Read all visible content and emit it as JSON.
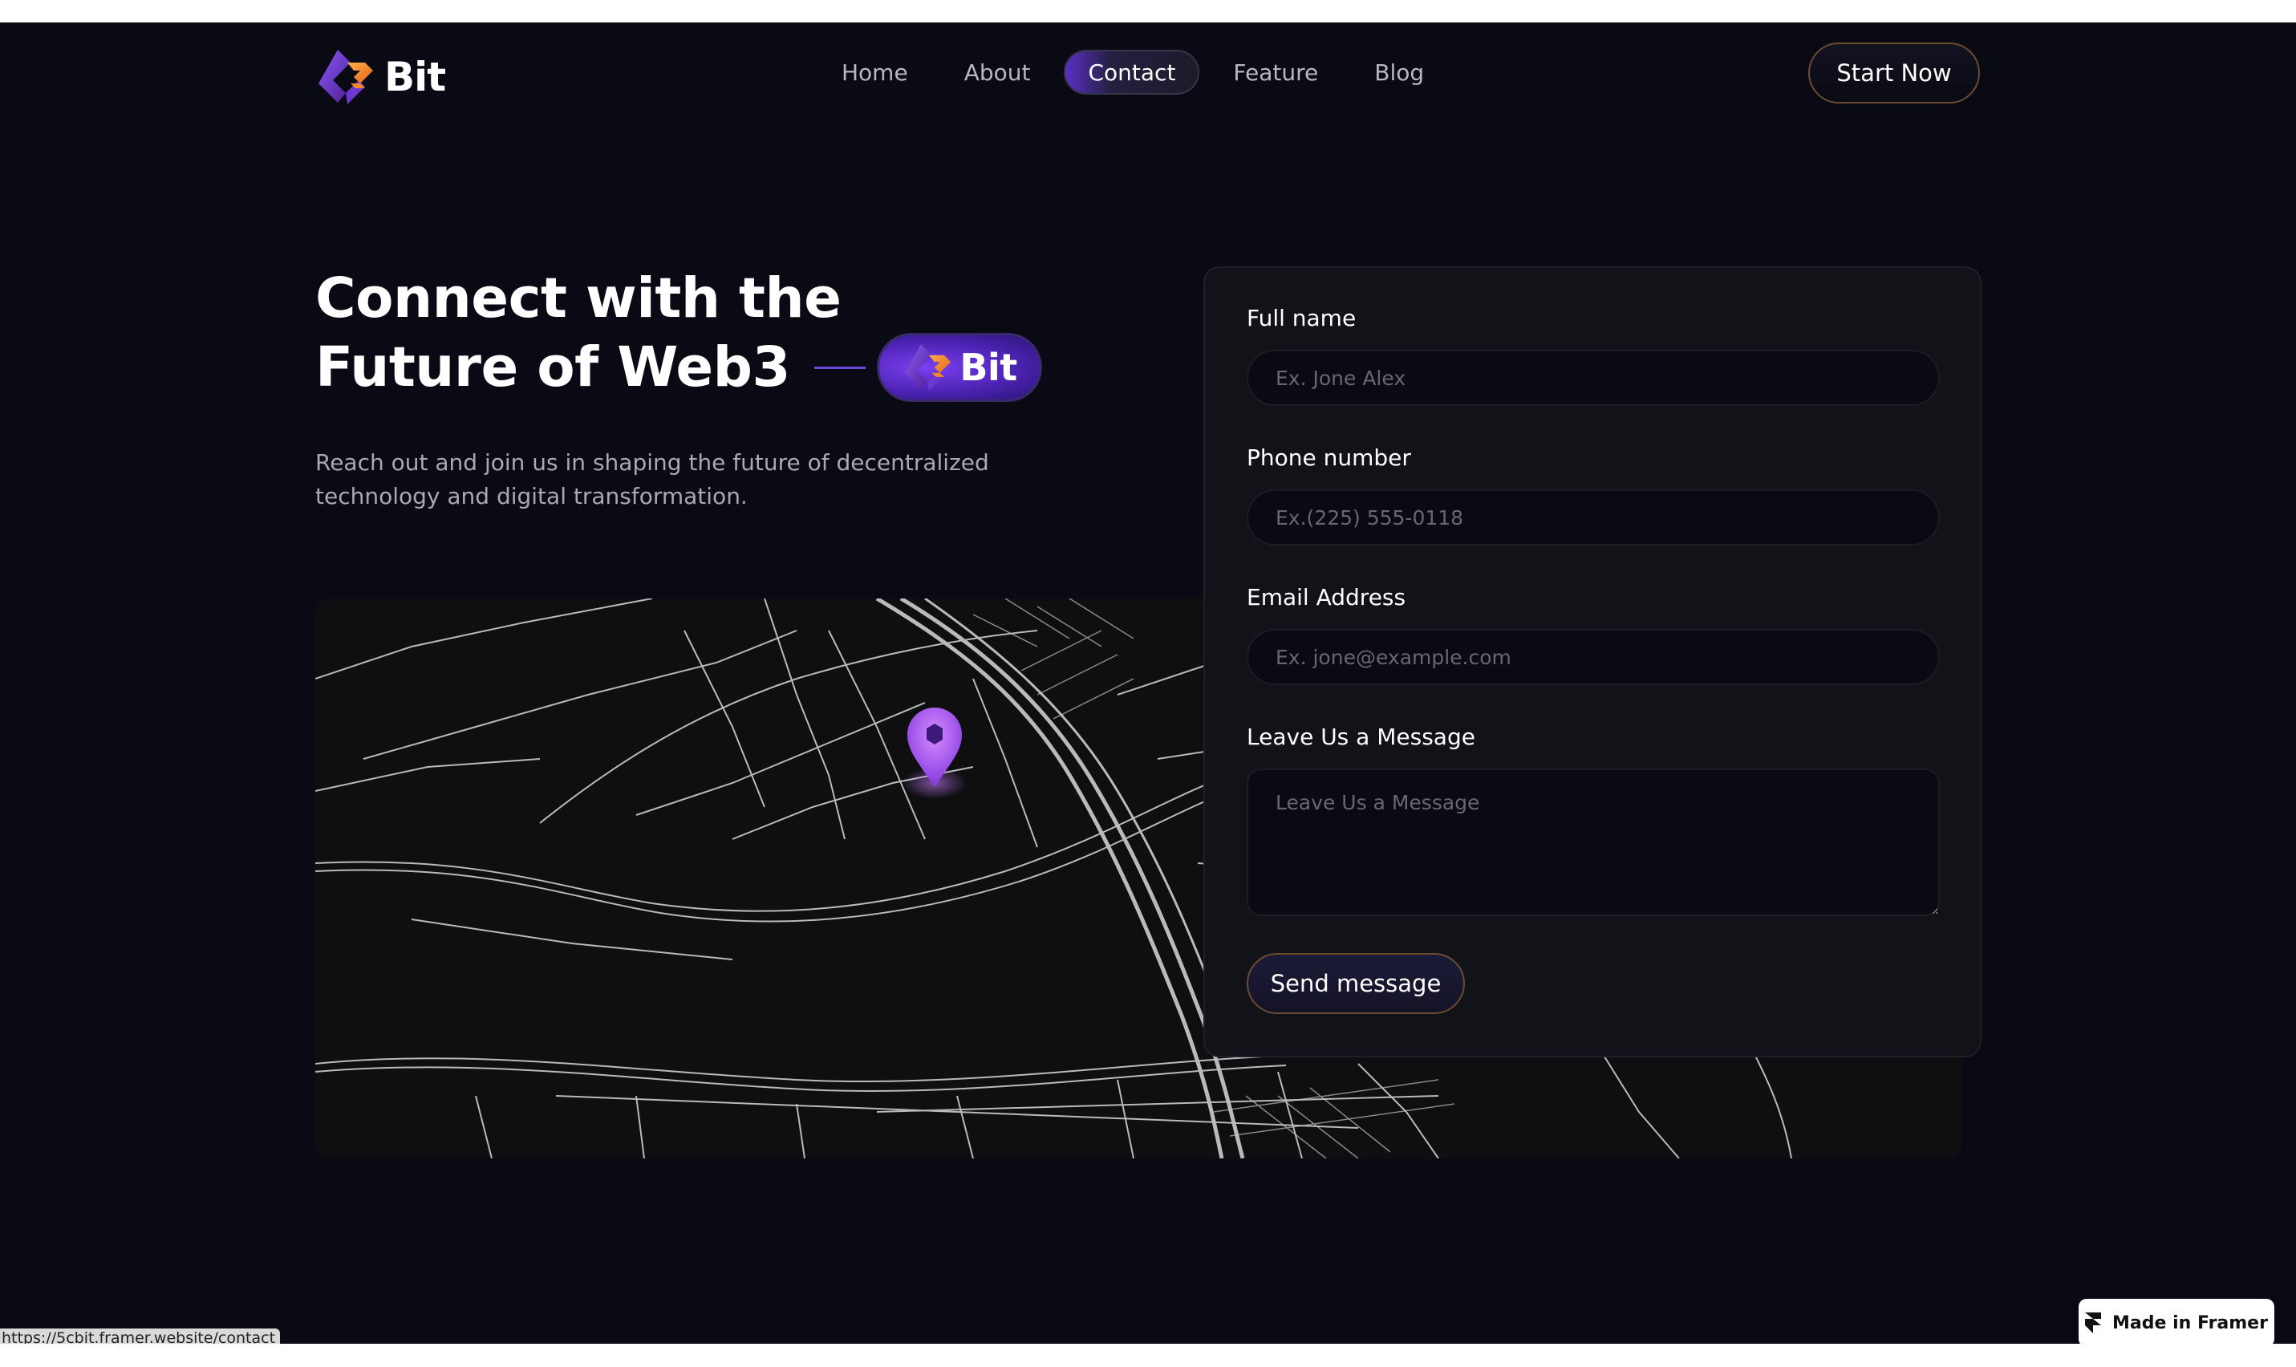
{
  "brand": {
    "name": "Bit"
  },
  "nav": {
    "items": [
      {
        "label": "Home",
        "active": false
      },
      {
        "label": "About",
        "active": false
      },
      {
        "label": "Contact",
        "active": true
      },
      {
        "label": "Feature",
        "active": false
      },
      {
        "label": "Blog",
        "active": false
      }
    ],
    "cta_label": "Start Now"
  },
  "hero": {
    "title_line1": "Connect with the",
    "title_line2": "Future of Web3",
    "badge_text": "Bit",
    "description": "Reach out and join us in shaping the future of decentralized technology and digital transformation."
  },
  "form": {
    "full_name": {
      "label": "Full name",
      "placeholder": "Ex. Jone Alex",
      "value": ""
    },
    "phone": {
      "label": "Phone number",
      "placeholder": "Ex.(225) 555-0118",
      "value": ""
    },
    "email": {
      "label": "Email Address",
      "placeholder": "Ex. jone@example.com",
      "value": ""
    },
    "message": {
      "label": "Leave Us a Message",
      "placeholder": "Leave Us a Message",
      "value": ""
    },
    "submit_label": "Send message"
  },
  "status_bar": {
    "url": "https://5cbit.framer.website/contact"
  },
  "framer_badge": {
    "label": "Made in Framer"
  },
  "colors": {
    "background": "#090a13",
    "card": "#121318",
    "accent_purple": "#6a48d8",
    "accent_orange": "#f08a2c",
    "pin": "#b36cf2"
  },
  "icons": [
    "bit-logo-icon",
    "map-pin-icon",
    "framer-icon",
    "resize-handle-icon"
  ]
}
